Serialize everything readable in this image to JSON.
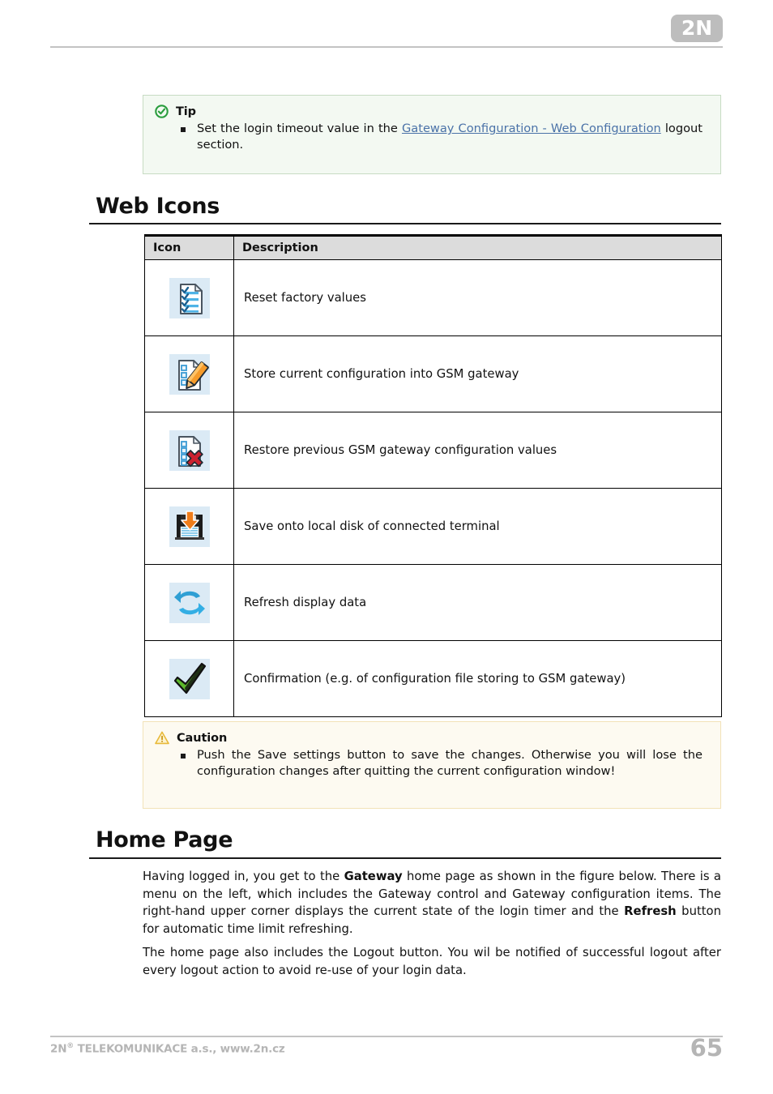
{
  "header": {
    "logo_text": "2N"
  },
  "tip": {
    "icon": "check-circle-icon",
    "title": "Tip",
    "text_before": "Set the login timeout value in the ",
    "link_text": "Gateway Configuration - Web Configuration",
    "text_after": " logout section."
  },
  "sections": {
    "web_icons_title": "Web Icons",
    "home_page_title": "Home Page"
  },
  "icon_table": {
    "headers": [
      "Icon",
      "Description"
    ],
    "rows": [
      {
        "icon": "reset-factory-values-icon",
        "description": "Reset factory values"
      },
      {
        "icon": "store-configuration-icon",
        "description": "Store current configuration into GSM gateway"
      },
      {
        "icon": "restore-configuration-icon",
        "description": "Restore previous GSM gateway configuration values"
      },
      {
        "icon": "save-to-disk-icon",
        "description": "Save onto local disk of connected terminal"
      },
      {
        "icon": "refresh-icon",
        "description": "Refresh display data"
      },
      {
        "icon": "confirmation-check-icon",
        "description": "Confirmation (e.g. of configuration file storing to GSM gateway)"
      }
    ]
  },
  "caution": {
    "icon": "warning-triangle-icon",
    "title": "Caution",
    "text": "Push the Save settings button to save the changes. Otherwise you will lose the configuration changes after quitting the current configuration window!"
  },
  "home_page": {
    "paragraph1": {
      "p1": "Having logged in, you get to the ",
      "b1": "Gateway",
      "p2": " home page as shown in the figure below. There is a menu on the left, which includes the Gateway control and Gateway configuration items. The right-hand upper corner displays the current state of the login timer and the ",
      "b2": "Refresh",
      "p3": " button for automatic time limit refreshing."
    },
    "paragraph2": "The home page also includes the Logout button. You wil be notified of successful logout after every logout action to avoid re-use of your login data."
  },
  "footer": {
    "company_prefix": "2N",
    "company_sup": "®",
    "company_rest": " TELEKOMUNIKACE a.s., www.2n.cz",
    "page_number": "65"
  },
  "colors": {
    "tip_border": "#c7dbc3",
    "tip_bg": "#f3f9f2",
    "caution_border": "#f2e2b8",
    "caution_bg": "#fdfaf1",
    "link": "#4a72a8",
    "icon_bg": "#dbeaf5",
    "table_header_bg": "#dcdcdc",
    "footer_gray": "#b5b5b5"
  }
}
